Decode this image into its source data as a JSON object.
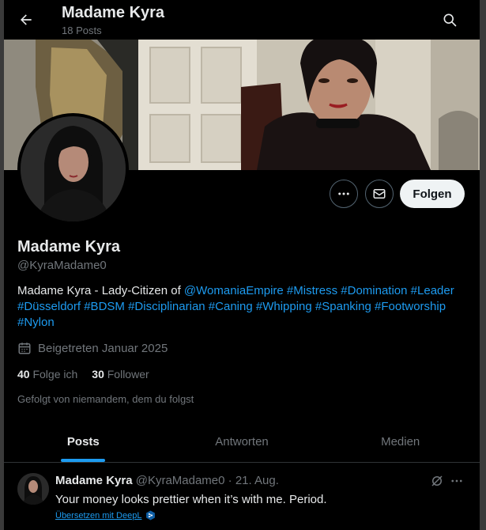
{
  "header": {
    "name": "Madame Kyra",
    "post_count": "18 Posts"
  },
  "profile": {
    "name": "Madame Kyra",
    "handle": "@KyraMadame0",
    "follow_label": "Folgen",
    "bio": {
      "prefix": "Madame Kyra - Lady-Citizen of ",
      "mention": "@WomaniaEmpire",
      "hashtags": [
        "#Mistress",
        "#Domination",
        "#Leader",
        "#Düsseldorf",
        "#BDSM",
        "#Disciplinarian",
        "#Caning",
        "#Whipping",
        "#Spanking",
        "#Footworship",
        "#Nylon"
      ]
    },
    "joined": "Beigetreten Januar 2025",
    "following_count": "40",
    "following_label": "Folge ich",
    "followers_count": "30",
    "followers_label": "Follower",
    "followed_by": "Gefolgt von niemandem, dem du folgst"
  },
  "tabs": [
    {
      "label": "Posts",
      "active": true
    },
    {
      "label": "Antworten",
      "active": false
    },
    {
      "label": "Medien",
      "active": false
    }
  ],
  "post": {
    "name": "Madame Kyra",
    "handle": "@KyraMadame0",
    "date": "· 21. Aug.",
    "text": "Your money looks prettier when it’s with me. Period.",
    "translate_label": "Übersetzen mit DeepL"
  },
  "icons": {
    "back": "arrow-left-icon",
    "search": "search-icon",
    "more": "more-horizontal-icon",
    "message": "envelope-icon",
    "calendar": "calendar-icon",
    "grok": "grok-icon",
    "deepl": "deepl-icon"
  },
  "colors": {
    "accent": "#1d9bf0",
    "background": "#000000",
    "text_primary": "#e7e9ea",
    "text_secondary": "#71767b",
    "follow_button": "#eff3f4"
  }
}
